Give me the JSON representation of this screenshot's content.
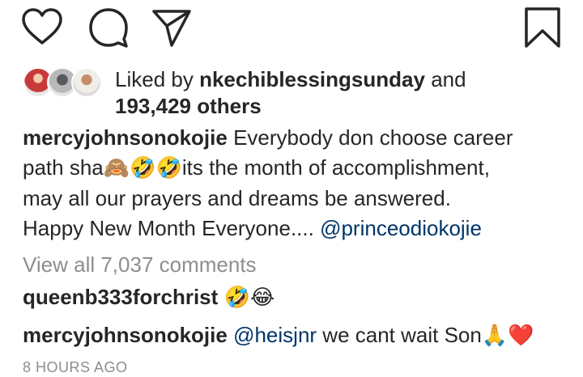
{
  "actions": {
    "like_icon": "heart-icon",
    "comment_icon": "comment-icon",
    "share_icon": "paper-plane-icon",
    "save_icon": "bookmark-icon"
  },
  "likes": {
    "prefix": "Liked by",
    "user": "nkechiblessingsunday",
    "joiner": "and",
    "others": "193,429 others"
  },
  "caption": {
    "username": "mercyjohnsonokojie",
    "line1": "Everybody don choose career",
    "line2a": "path sha",
    "emojis": "🙈🤣🤣",
    "line2b": "its the month of accomplishment,",
    "line3": "may all our prayers and dreams be answered.",
    "line4": "Happy New Month Everyone....",
    "mention": "@princeodiokojie"
  },
  "view_all_comments": "View all 7,037 comments",
  "comments": [
    {
      "username": "queenb333forchrist",
      "text": "🤣😂"
    },
    {
      "username": "mercyjohnsonokojie",
      "mention": "@heisjnr",
      "text": " we cant wait Son",
      "emojis": "🙏❤️"
    }
  ],
  "timestamp": "8 HOURS AGO",
  "colors": {
    "text": "#262626",
    "muted": "#8e8e8e",
    "mention": "#003569",
    "heart_red": "#ed4956"
  }
}
